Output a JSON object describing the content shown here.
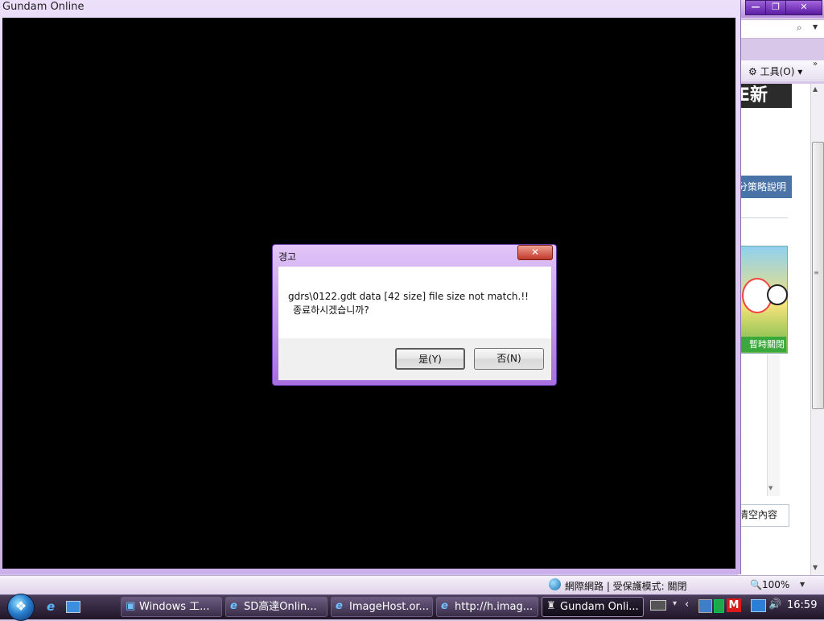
{
  "game_window": {
    "title": "Gundam Online"
  },
  "dialog": {
    "title": "경고",
    "close_glyph": "✕",
    "message_line1": "gdrs\\0122.gdt data [42 size] file size not match.!!",
    "message_line2": "종료하시겠습니까?",
    "yes_label": "是(Y)",
    "no_label": "否(N)"
  },
  "browser": {
    "window_buttons": {
      "minimize": "—",
      "maximize": "❐",
      "close": "✕"
    },
    "tools_menu": "⚙ 工具(O) ▾",
    "banner_text": "E新",
    "blue_tab": "分策略說明",
    "ad_bar": "暫時關閉",
    "clear_link": "清空內容",
    "status_zone": "網際網路 | 受保護模式: 關閉",
    "zoom": "🔍100%"
  },
  "taskbar": {
    "tasks": [
      {
        "label": "Windows 工...",
        "icon": "windows-explorer-icon"
      },
      {
        "label": "SD高達Onlin...",
        "icon": "internet-explorer-icon"
      },
      {
        "label": "ImageHost.or...",
        "icon": "internet-explorer-icon"
      },
      {
        "label": "http://h.imag...",
        "icon": "internet-explorer-icon"
      },
      {
        "label": "Gundam Onli...",
        "icon": "gundam-icon"
      }
    ],
    "tray_letter": "M",
    "clock": "16:59"
  },
  "colors": {
    "window_frame": "#cbb0ea",
    "game_canvas": "#000000",
    "taskbar": "#2a2036",
    "dialog_close": "#c0392b"
  }
}
